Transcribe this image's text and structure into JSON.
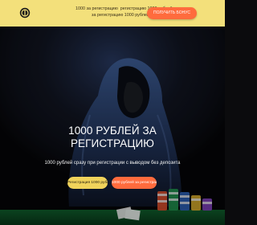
{
  "topbar": {
    "promo_line1": "1000 за регистрацию",
    "promo_line1b": "регистрацию 1000 рублей",
    "promo_line2": "за регистрацию 1000 рублей",
    "cta_label": "ПОЛУЧИТЬ БОНУС"
  },
  "hero": {
    "title_line1": "1000 РУБЛЕЙ ЗА",
    "title_line2": "РЕГИСТРАЦИЮ",
    "subtitle": "1000 рублей сразу при регистрации с выводом без депозита",
    "buttons": {
      "register": "Регистрация 1000 рублей",
      "bonus": "1000 рублей за регистрацию"
    }
  },
  "colors": {
    "topbar_bg": "#f3e07b",
    "accent_orange": "#ff6b3d",
    "accent_yellow": "#f0d35b",
    "hero_bg": "#0a0b0e"
  },
  "icons": {
    "logo": "dollar-coin-icon"
  }
}
